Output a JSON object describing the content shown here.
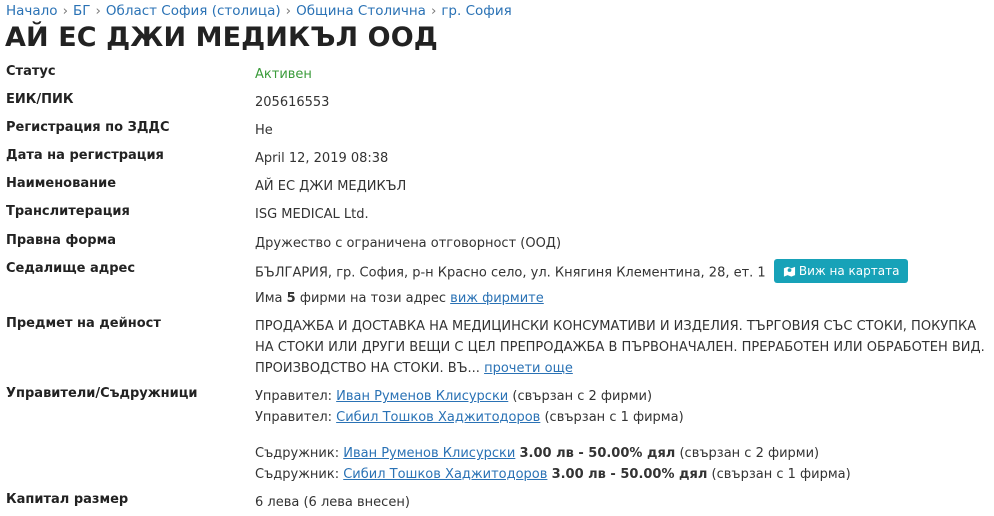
{
  "breadcrumb": {
    "items": [
      "Начало",
      "БГ",
      "Област София (столица)",
      "Община Столична",
      "гр. София"
    ],
    "separator": "›"
  },
  "company_title": "АЙ ЕС ДЖИ МЕДИКЪЛ ООД",
  "fields": {
    "status": {
      "label": "Статус",
      "value": "Активен"
    },
    "eik": {
      "label": "ЕИК/ПИК",
      "value": "205616553"
    },
    "vat": {
      "label": "Регистрация по ЗДДС",
      "value": "Не"
    },
    "reg_date": {
      "label": "Дата на регистрация",
      "value": "April 12, 2019 08:38"
    },
    "name": {
      "label": "Наименование",
      "value": "АЙ ЕС ДЖИ МЕДИКЪЛ"
    },
    "translit": {
      "label": "Транслитерация",
      "value": "ISG MEDICAL Ltd."
    },
    "legal_form": {
      "label": "Правна форма",
      "value": "Дружество с ограничена отговорност (ООД)"
    },
    "address": {
      "label": "Седалище адрес",
      "value": "БЪЛГАРИЯ, гр. София, р-н Красно село, ул. Княгиня Клементина, 28, ет. 1",
      "map_button": "Виж на картата",
      "firms_prefix": "Има",
      "firms_count": "5",
      "firms_suffix": "фирми на този адрес",
      "firms_link": "виж фирмите"
    },
    "activity": {
      "label": "Предмет на дейност",
      "lines": [
        "ПРОДАЖБА И ДОСТАВКА НА МЕДИЦИНСКИ КОНСУМАТИВИ И ИЗДЕЛИЯ. ТЪРГОВИЯ СЪС СТОКИ, ПОКУПКА",
        "НА СТОКИ ИЛИ ДРУГИ ВЕЩИ С ЦЕЛ ПРЕПРОДАЖБА В ПЪРВОНАЧАЛЕН. ПРЕРАБОТЕН ИЛИ ОБРАБОТЕН ВИД.",
        "ПРОИЗВОДСТВО НА СТОКИ. ВЪ..."
      ],
      "read_more": "прочети още"
    },
    "managers": {
      "label": "Управители/Съдружници",
      "managers": [
        {
          "role": "Управител:",
          "name": "Иван Руменов Клисурски",
          "note": "(свързан с 2 фирми)"
        },
        {
          "role": "Управител:",
          "name": "Сибил Тошков Хаджитодоров",
          "note": "(свързан с 1 фирма)"
        }
      ],
      "partners": [
        {
          "role": "Съдружник:",
          "name": "Иван Руменов Клисурски",
          "share": "3.00 лв - 50.00% дял",
          "note": "(свързан с 2 фирми)"
        },
        {
          "role": "Съдружник:",
          "name": "Сибил Тошков Хаджитодоров",
          "share": "3.00 лв - 50.00% дял",
          "note": "(свързан с 1 фирма)"
        }
      ]
    },
    "capital": {
      "label": "Капитал размер",
      "value": "6 лева (6 лева внесен)"
    }
  },
  "colors": {
    "link": "#2a72b5",
    "status_active": "#3a9b3a",
    "map_button": "#17a2b8"
  },
  "icons": {
    "map_button": "map-marker-icon"
  }
}
